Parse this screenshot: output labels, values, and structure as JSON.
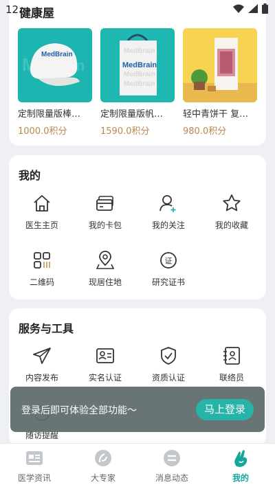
{
  "status": {
    "time": "12:"
  },
  "header": {
    "title": "健康屋"
  },
  "shop": {
    "products": [
      {
        "name": "定制限量版棒…",
        "price": "1000.0积分",
        "logo": "MedBrain"
      },
      {
        "name": "定制限量版帆…",
        "price": "1590.0积分",
        "logo": "MedBrain"
      },
      {
        "name": "轻中青饼干 复…",
        "price": "980.0积分",
        "logo": ""
      }
    ]
  },
  "mine": {
    "title": "我的",
    "items": [
      {
        "label": "医生主页",
        "icon": "home-icon"
      },
      {
        "label": "我的卡包",
        "icon": "card-wallet-icon"
      },
      {
        "label": "我的关注",
        "icon": "user-follow-icon"
      },
      {
        "label": "我的收藏",
        "icon": "star-icon"
      },
      {
        "label": "二维码",
        "icon": "qrcode-icon"
      },
      {
        "label": "现居住地",
        "icon": "location-icon"
      },
      {
        "label": "研究证书",
        "icon": "certificate-icon"
      }
    ]
  },
  "tools": {
    "title": "服务与工具",
    "items": [
      {
        "label": "内容发布",
        "icon": "send-icon"
      },
      {
        "label": "实名认证",
        "icon": "id-card-icon"
      },
      {
        "label": "资质认证",
        "icon": "shield-check-icon"
      },
      {
        "label": "联络员",
        "icon": "contact-book-icon"
      },
      {
        "label": "随访提醒",
        "icon": "followup-icon"
      }
    ]
  },
  "toast": {
    "message": "登录后即可体验全部功能～",
    "button": "马上登录"
  },
  "tabbar": {
    "tabs": [
      {
        "label": "医学资讯",
        "icon": "news-icon"
      },
      {
        "label": "大专家",
        "icon": "expert-icon"
      },
      {
        "label": "消息动态",
        "icon": "message-icon"
      },
      {
        "label": "我的",
        "icon": "mine-icon"
      }
    ],
    "active_index": 3
  },
  "colors": {
    "accent": "#27b3a8",
    "price": "#b9874f",
    "tab_active": "#16a69b"
  }
}
